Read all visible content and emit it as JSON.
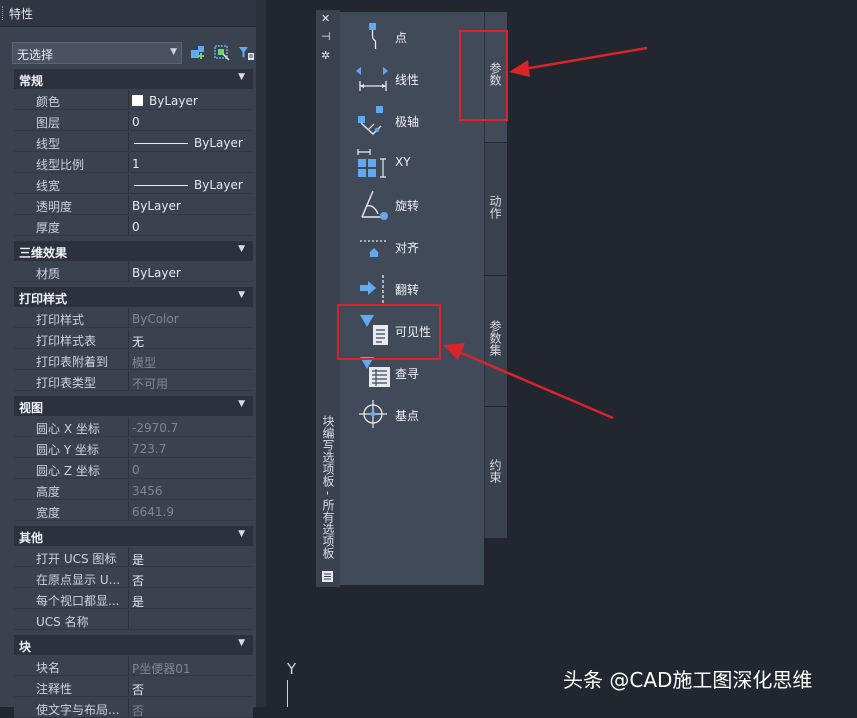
{
  "properties": {
    "title": "特性",
    "selection": "无选择",
    "sections": {
      "general": {
        "header": "常规",
        "rows": [
          {
            "label": "颜色",
            "value": "ByLayer"
          },
          {
            "label": "图层",
            "value": "0"
          },
          {
            "label": "线型",
            "value": "ByLayer"
          },
          {
            "label": "线型比例",
            "value": "1"
          },
          {
            "label": "线宽",
            "value": "ByLayer"
          },
          {
            "label": "透明度",
            "value": "ByLayer"
          },
          {
            "label": "厚度",
            "value": "0"
          }
        ]
      },
      "effects3d": {
        "header": "三维效果",
        "rows": [
          {
            "label": "材质",
            "value": "ByLayer"
          }
        ]
      },
      "plotstyle": {
        "header": "打印样式",
        "rows": [
          {
            "label": "打印样式",
            "value": "ByColor"
          },
          {
            "label": "打印样式表",
            "value": "无"
          },
          {
            "label": "打印表附着到",
            "value": "模型"
          },
          {
            "label": "打印表类型",
            "value": "不可用"
          }
        ]
      },
      "view": {
        "header": "视图",
        "rows": [
          {
            "label": "圆心 X 坐标",
            "value": "-2970.7"
          },
          {
            "label": "圆心 Y 坐标",
            "value": "723.7"
          },
          {
            "label": "圆心 Z 坐标",
            "value": "0"
          },
          {
            "label": "高度",
            "value": "3456"
          },
          {
            "label": "宽度",
            "value": "6641.9"
          }
        ]
      },
      "misc": {
        "header": "其他",
        "rows": [
          {
            "label": "打开 UCS 图标",
            "value": "是"
          },
          {
            "label": "在原点显示 U...",
            "value": "否"
          },
          {
            "label": "每个视口都显...",
            "value": "是"
          },
          {
            "label": "UCS 名称",
            "value": ""
          }
        ]
      },
      "block": {
        "header": "块",
        "rows": [
          {
            "label": "块名",
            "value": "P坐便器01"
          },
          {
            "label": "注释性",
            "value": "否"
          },
          {
            "label": "使文字与布局...",
            "value": "否"
          }
        ]
      }
    }
  },
  "palette": {
    "title": "块编写选项板 - 所有选项板",
    "controls": {
      "close": "✕",
      "pin": "⊣",
      "settings": "✲"
    },
    "tools": [
      {
        "label": "点",
        "icon": "point-param-icon"
      },
      {
        "label": "线性",
        "icon": "linear-param-icon"
      },
      {
        "label": "极轴",
        "icon": "polar-param-icon"
      },
      {
        "label": "XY",
        "icon": "xy-param-icon"
      },
      {
        "label": "旋转",
        "icon": "rotation-param-icon"
      },
      {
        "label": "对齐",
        "icon": "alignment-param-icon"
      },
      {
        "label": "翻转",
        "icon": "flip-param-icon"
      },
      {
        "label": "可见性",
        "icon": "visibility-param-icon"
      },
      {
        "label": "查寻",
        "icon": "lookup-param-icon"
      },
      {
        "label": "基点",
        "icon": "basepoint-param-icon"
      }
    ],
    "tabs": [
      "参数",
      "动作",
      "参数集",
      "约束"
    ]
  },
  "canvas": {
    "axis_label": "Y"
  },
  "watermark": "头条 @CAD施工图深化思维",
  "colors": {
    "accent_blue": "#63a9f0",
    "highlight_red": "#d9242a"
  }
}
